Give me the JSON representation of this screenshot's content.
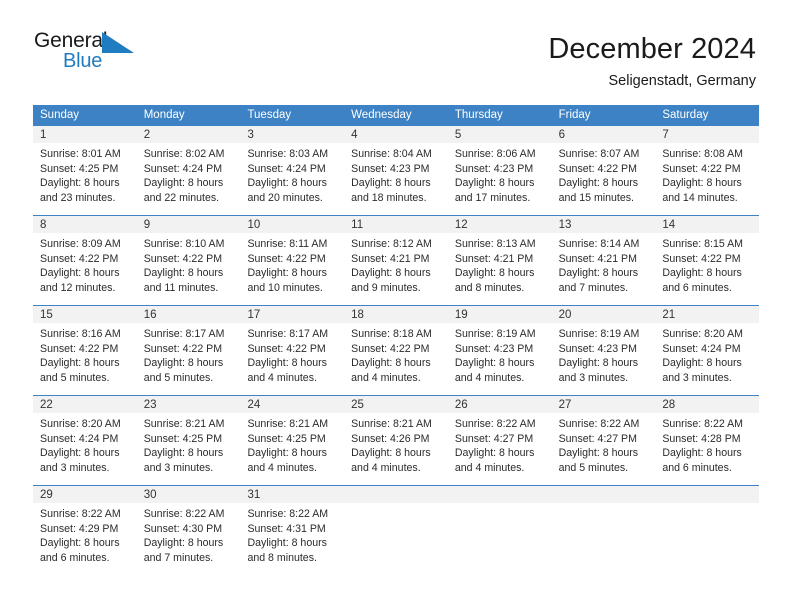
{
  "brand": {
    "name_part1": "General",
    "name_part2": "Blue",
    "triangle_icon": "triangle-icon",
    "accent_color": "#1f7cc1"
  },
  "header": {
    "title": "December 2024",
    "subtitle": "Seligenstadt, Germany"
  },
  "colors": {
    "header_blue": "#3d82c4",
    "daynum_band": "#f2f2f2",
    "text": "#2b2b2b"
  },
  "calendar": {
    "day_names": [
      "Sunday",
      "Monday",
      "Tuesday",
      "Wednesday",
      "Thursday",
      "Friday",
      "Saturday"
    ],
    "weeks": [
      [
        {
          "day": "1",
          "sunrise": "Sunrise: 8:01 AM",
          "sunset": "Sunset: 4:25 PM",
          "daylight1": "Daylight: 8 hours",
          "daylight2": "and 23 minutes."
        },
        {
          "day": "2",
          "sunrise": "Sunrise: 8:02 AM",
          "sunset": "Sunset: 4:24 PM",
          "daylight1": "Daylight: 8 hours",
          "daylight2": "and 22 minutes."
        },
        {
          "day": "3",
          "sunrise": "Sunrise: 8:03 AM",
          "sunset": "Sunset: 4:24 PM",
          "daylight1": "Daylight: 8 hours",
          "daylight2": "and 20 minutes."
        },
        {
          "day": "4",
          "sunrise": "Sunrise: 8:04 AM",
          "sunset": "Sunset: 4:23 PM",
          "daylight1": "Daylight: 8 hours",
          "daylight2": "and 18 minutes."
        },
        {
          "day": "5",
          "sunrise": "Sunrise: 8:06 AM",
          "sunset": "Sunset: 4:23 PM",
          "daylight1": "Daylight: 8 hours",
          "daylight2": "and 17 minutes."
        },
        {
          "day": "6",
          "sunrise": "Sunrise: 8:07 AM",
          "sunset": "Sunset: 4:22 PM",
          "daylight1": "Daylight: 8 hours",
          "daylight2": "and 15 minutes."
        },
        {
          "day": "7",
          "sunrise": "Sunrise: 8:08 AM",
          "sunset": "Sunset: 4:22 PM",
          "daylight1": "Daylight: 8 hours",
          "daylight2": "and 14 minutes."
        }
      ],
      [
        {
          "day": "8",
          "sunrise": "Sunrise: 8:09 AM",
          "sunset": "Sunset: 4:22 PM",
          "daylight1": "Daylight: 8 hours",
          "daylight2": "and 12 minutes."
        },
        {
          "day": "9",
          "sunrise": "Sunrise: 8:10 AM",
          "sunset": "Sunset: 4:22 PM",
          "daylight1": "Daylight: 8 hours",
          "daylight2": "and 11 minutes."
        },
        {
          "day": "10",
          "sunrise": "Sunrise: 8:11 AM",
          "sunset": "Sunset: 4:22 PM",
          "daylight1": "Daylight: 8 hours",
          "daylight2": "and 10 minutes."
        },
        {
          "day": "11",
          "sunrise": "Sunrise: 8:12 AM",
          "sunset": "Sunset: 4:21 PM",
          "daylight1": "Daylight: 8 hours",
          "daylight2": "and 9 minutes."
        },
        {
          "day": "12",
          "sunrise": "Sunrise: 8:13 AM",
          "sunset": "Sunset: 4:21 PM",
          "daylight1": "Daylight: 8 hours",
          "daylight2": "and 8 minutes."
        },
        {
          "day": "13",
          "sunrise": "Sunrise: 8:14 AM",
          "sunset": "Sunset: 4:21 PM",
          "daylight1": "Daylight: 8 hours",
          "daylight2": "and 7 minutes."
        },
        {
          "day": "14",
          "sunrise": "Sunrise: 8:15 AM",
          "sunset": "Sunset: 4:22 PM",
          "daylight1": "Daylight: 8 hours",
          "daylight2": "and 6 minutes."
        }
      ],
      [
        {
          "day": "15",
          "sunrise": "Sunrise: 8:16 AM",
          "sunset": "Sunset: 4:22 PM",
          "daylight1": "Daylight: 8 hours",
          "daylight2": "and 5 minutes."
        },
        {
          "day": "16",
          "sunrise": "Sunrise: 8:17 AM",
          "sunset": "Sunset: 4:22 PM",
          "daylight1": "Daylight: 8 hours",
          "daylight2": "and 5 minutes."
        },
        {
          "day": "17",
          "sunrise": "Sunrise: 8:17 AM",
          "sunset": "Sunset: 4:22 PM",
          "daylight1": "Daylight: 8 hours",
          "daylight2": "and 4 minutes."
        },
        {
          "day": "18",
          "sunrise": "Sunrise: 8:18 AM",
          "sunset": "Sunset: 4:22 PM",
          "daylight1": "Daylight: 8 hours",
          "daylight2": "and 4 minutes."
        },
        {
          "day": "19",
          "sunrise": "Sunrise: 8:19 AM",
          "sunset": "Sunset: 4:23 PM",
          "daylight1": "Daylight: 8 hours",
          "daylight2": "and 4 minutes."
        },
        {
          "day": "20",
          "sunrise": "Sunrise: 8:19 AM",
          "sunset": "Sunset: 4:23 PM",
          "daylight1": "Daylight: 8 hours",
          "daylight2": "and 3 minutes."
        },
        {
          "day": "21",
          "sunrise": "Sunrise: 8:20 AM",
          "sunset": "Sunset: 4:24 PM",
          "daylight1": "Daylight: 8 hours",
          "daylight2": "and 3 minutes."
        }
      ],
      [
        {
          "day": "22",
          "sunrise": "Sunrise: 8:20 AM",
          "sunset": "Sunset: 4:24 PM",
          "daylight1": "Daylight: 8 hours",
          "daylight2": "and 3 minutes."
        },
        {
          "day": "23",
          "sunrise": "Sunrise: 8:21 AM",
          "sunset": "Sunset: 4:25 PM",
          "daylight1": "Daylight: 8 hours",
          "daylight2": "and 3 minutes."
        },
        {
          "day": "24",
          "sunrise": "Sunrise: 8:21 AM",
          "sunset": "Sunset: 4:25 PM",
          "daylight1": "Daylight: 8 hours",
          "daylight2": "and 4 minutes."
        },
        {
          "day": "25",
          "sunrise": "Sunrise: 8:21 AM",
          "sunset": "Sunset: 4:26 PM",
          "daylight1": "Daylight: 8 hours",
          "daylight2": "and 4 minutes."
        },
        {
          "day": "26",
          "sunrise": "Sunrise: 8:22 AM",
          "sunset": "Sunset: 4:27 PM",
          "daylight1": "Daylight: 8 hours",
          "daylight2": "and 4 minutes."
        },
        {
          "day": "27",
          "sunrise": "Sunrise: 8:22 AM",
          "sunset": "Sunset: 4:27 PM",
          "daylight1": "Daylight: 8 hours",
          "daylight2": "and 5 minutes."
        },
        {
          "day": "28",
          "sunrise": "Sunrise: 8:22 AM",
          "sunset": "Sunset: 4:28 PM",
          "daylight1": "Daylight: 8 hours",
          "daylight2": "and 6 minutes."
        }
      ],
      [
        {
          "day": "29",
          "sunrise": "Sunrise: 8:22 AM",
          "sunset": "Sunset: 4:29 PM",
          "daylight1": "Daylight: 8 hours",
          "daylight2": "and 6 minutes."
        },
        {
          "day": "30",
          "sunrise": "Sunrise: 8:22 AM",
          "sunset": "Sunset: 4:30 PM",
          "daylight1": "Daylight: 8 hours",
          "daylight2": "and 7 minutes."
        },
        {
          "day": "31",
          "sunrise": "Sunrise: 8:22 AM",
          "sunset": "Sunset: 4:31 PM",
          "daylight1": "Daylight: 8 hours",
          "daylight2": "and 8 minutes."
        },
        {
          "day": "",
          "sunrise": "",
          "sunset": "",
          "daylight1": "",
          "daylight2": ""
        },
        {
          "day": "",
          "sunrise": "",
          "sunset": "",
          "daylight1": "",
          "daylight2": ""
        },
        {
          "day": "",
          "sunrise": "",
          "sunset": "",
          "daylight1": "",
          "daylight2": ""
        },
        {
          "day": "",
          "sunrise": "",
          "sunset": "",
          "daylight1": "",
          "daylight2": ""
        }
      ]
    ]
  }
}
